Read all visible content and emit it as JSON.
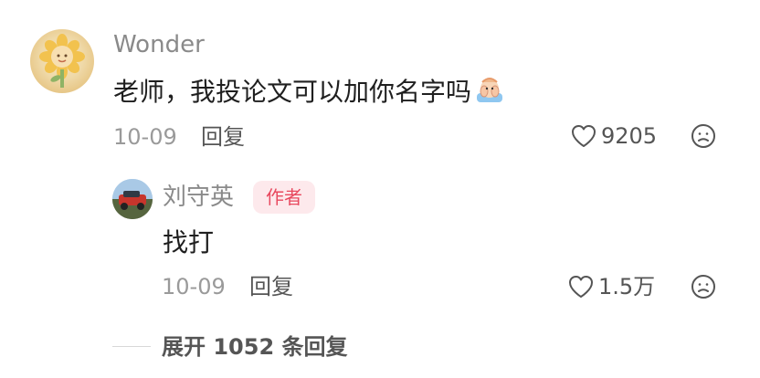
{
  "comment": {
    "username": "Wonder",
    "text": "老师，我投论文可以加你名字吗",
    "emoji": "hands-covering-face-emoji",
    "date": "10-09",
    "reply_label": "回复",
    "likes": "9205",
    "avatar": "sunflower-avatar"
  },
  "reply": {
    "username": "刘守英",
    "badge": "作者",
    "text": "找打",
    "date": "10-09",
    "reply_label": "回复",
    "likes": "1.5万",
    "avatar": "red-car-avatar"
  },
  "expand": {
    "label": "展开 1052 条回复"
  },
  "icons": {
    "like": "heart-outline-icon",
    "dislike": "frown-face-icon"
  },
  "colors": {
    "badge_bg": "#fde9ec",
    "badge_text": "#e8495f",
    "username": "#8a8a8a",
    "body_text": "#1f1f1f"
  }
}
